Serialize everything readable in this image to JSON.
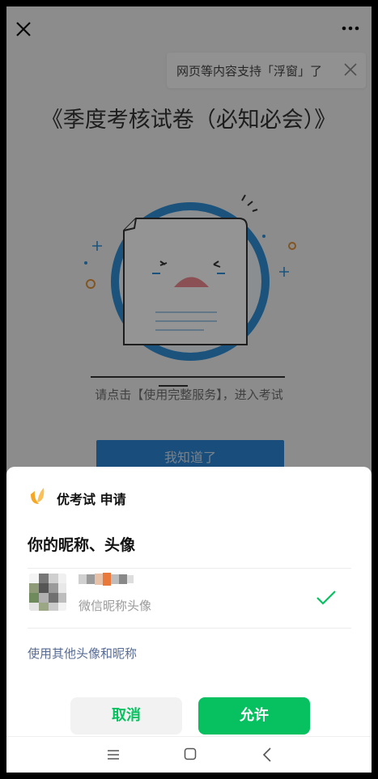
{
  "page": {
    "toast_text": "网页等内容支持「浮窗」了",
    "title": "《季度考核试卷（必知必会）》",
    "hint": "请点击【使用完整服务】，进入考试",
    "know_button": "我知道了"
  },
  "sheet": {
    "app_name": "优考试",
    "action": "申请",
    "title": "你的昵称、头像",
    "nickname_label": "微信昵称头像",
    "other_link": "使用其他头像和昵称",
    "cancel_label": "取消",
    "allow_label": "允许"
  },
  "colors": {
    "accent_green": "#07c160",
    "link_blue": "#576b95",
    "page_blue": "#2a85d6"
  },
  "icons": [
    "close-icon",
    "more-icon",
    "toast-close-icon",
    "app-logo-icon",
    "checkmark-icon",
    "nav-menu-icon",
    "nav-home-icon",
    "nav-back-icon"
  ]
}
